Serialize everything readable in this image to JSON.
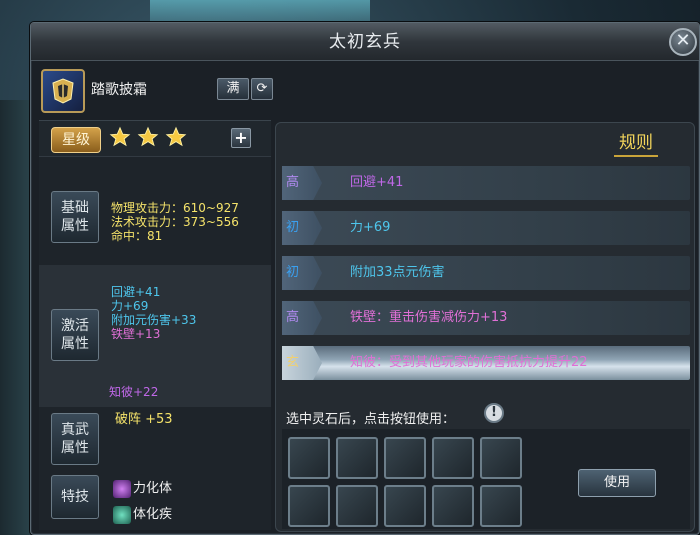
{
  "window": {
    "title": "太初玄兵",
    "close_label": "✕"
  },
  "item": {
    "name": "踏歌披霜",
    "max_label": "满",
    "refresh_label": "C"
  },
  "star": {
    "label": "星级",
    "count": 3,
    "plus_label": "+"
  },
  "base_attr": {
    "label_top": "基础",
    "label_bottom": "属性",
    "lines": [
      "物理攻击力：610~927",
      "法术攻击力：373~556",
      "命中：81"
    ]
  },
  "active_attr": {
    "label_top": "激活",
    "label_bottom": "属性",
    "lines": [
      {
        "text": "回避+41",
        "color": "cyan"
      },
      {
        "text": "力+69",
        "color": "cyan"
      },
      {
        "text": "附加元伤害+33",
        "color": "cyan"
      },
      {
        "text": "铁壁+13",
        "color": "pink"
      }
    ],
    "extra": "知彼+22"
  },
  "true_attr": {
    "label_top": "真武",
    "label_bottom": "属性",
    "value": "破阵 +53"
  },
  "skill": {
    "label": "特技",
    "items": [
      "力化体",
      "体化疾"
    ]
  },
  "rules_label": "规则",
  "slots": [
    {
      "tier": "高",
      "tier_color": "purple",
      "text": "回避+41",
      "text_color": "#c068e8"
    },
    {
      "tier": "初",
      "tier_color": "blue",
      "text": "力+69",
      "text_color": "#4ec6ec"
    },
    {
      "tier": "初",
      "tier_color": "blue",
      "text": "附加33点元伤害",
      "text_color": "#4ec6ec"
    },
    {
      "tier": "高",
      "tier_color": "purple",
      "text": "铁壁：重击伤害减伤力+13",
      "text_color": "#e070d6"
    },
    {
      "tier": "玄",
      "tier_color": "gold",
      "text": "知彼：受到其他玩家的伤害抵抗力提升22",
      "text_color": "#e070d6"
    }
  ],
  "instruction": "选中灵石后，点击按钮使用：",
  "info_icon": "!",
  "use_label": "使用"
}
